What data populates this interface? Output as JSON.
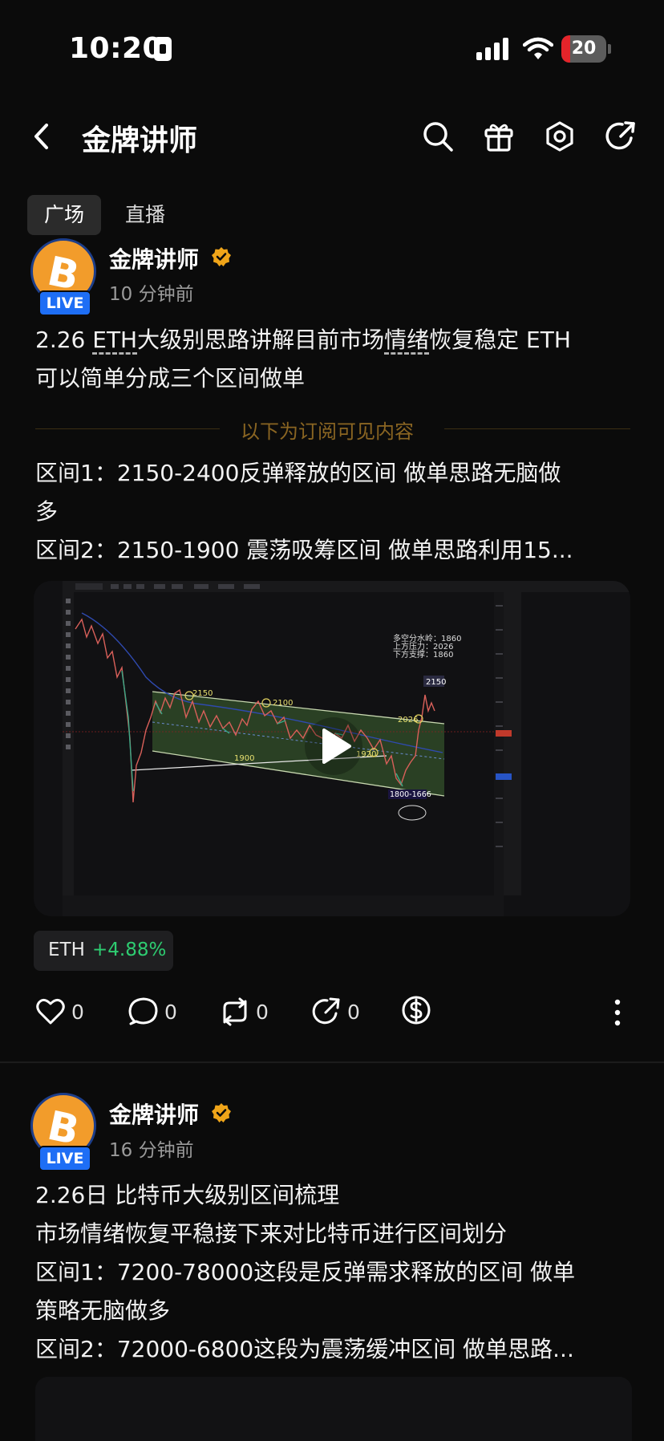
{
  "status_bar": {
    "time": "10:20",
    "battery": "20",
    "battery_level": 0.2
  },
  "header": {
    "title": "金牌讲师",
    "icons": [
      "back-icon",
      "search-icon",
      "gift-icon",
      "settings-icon",
      "share-icon"
    ]
  },
  "tabs": [
    {
      "label": "广场",
      "active": true
    },
    {
      "label": "直播",
      "active": false
    }
  ],
  "posts": [
    {
      "author": "金牌讲师",
      "live_label": "LIVE",
      "time_ago": "10 分钟前",
      "text_line1_a": "2.26 ",
      "text_line1_b": "ETH",
      "text_line1_c": "大级别思路讲解目前市场",
      "text_line1_d": "情绪",
      "text_line1_e": "恢复稳定 ETH",
      "text_line2": "可以简单分成三个区间做单",
      "subscribe_divider": "以下为订阅可见内容",
      "content_lines": [
        "区间1：2150-2400反弹释放的区间 做单思路无脑做",
        "多",
        "区间2：2150-1900 震荡吸筹区间 做单思路利用15..."
      ],
      "chart_annotations": {
        "info": [
          "多空分水岭：1860",
          "上方压力：2026",
          "下方支撑：1860"
        ],
        "levels": [
          "2150",
          "2100",
          "1900",
          "1920",
          "2026",
          "2150",
          "1800-1666"
        ]
      },
      "ticker": {
        "symbol": "ETH",
        "change": "+4.88%"
      },
      "actions": {
        "likes": "0",
        "comments": "0",
        "reposts": "0",
        "shares": "0"
      }
    },
    {
      "author": "金牌讲师",
      "live_label": "LIVE",
      "time_ago": "16 分钟前",
      "content_lines": [
        "2.26日 比特币大级别区间梳理",
        "市场情绪恢复平稳接下来对比特币进行区间划分",
        "区间1：7200-78000这段是反弹需求释放的区间 做单",
        "策略无脑做多",
        "区间2：72000-6800这段为震荡缓冲区间 做单思路..."
      ]
    }
  ],
  "colors": {
    "background": "#0b0b0b",
    "accent_gold": "#8a6522",
    "live_blue": "#1e6ef5",
    "positive_green": "#2ecc71",
    "battery_red": "#e5242a"
  }
}
